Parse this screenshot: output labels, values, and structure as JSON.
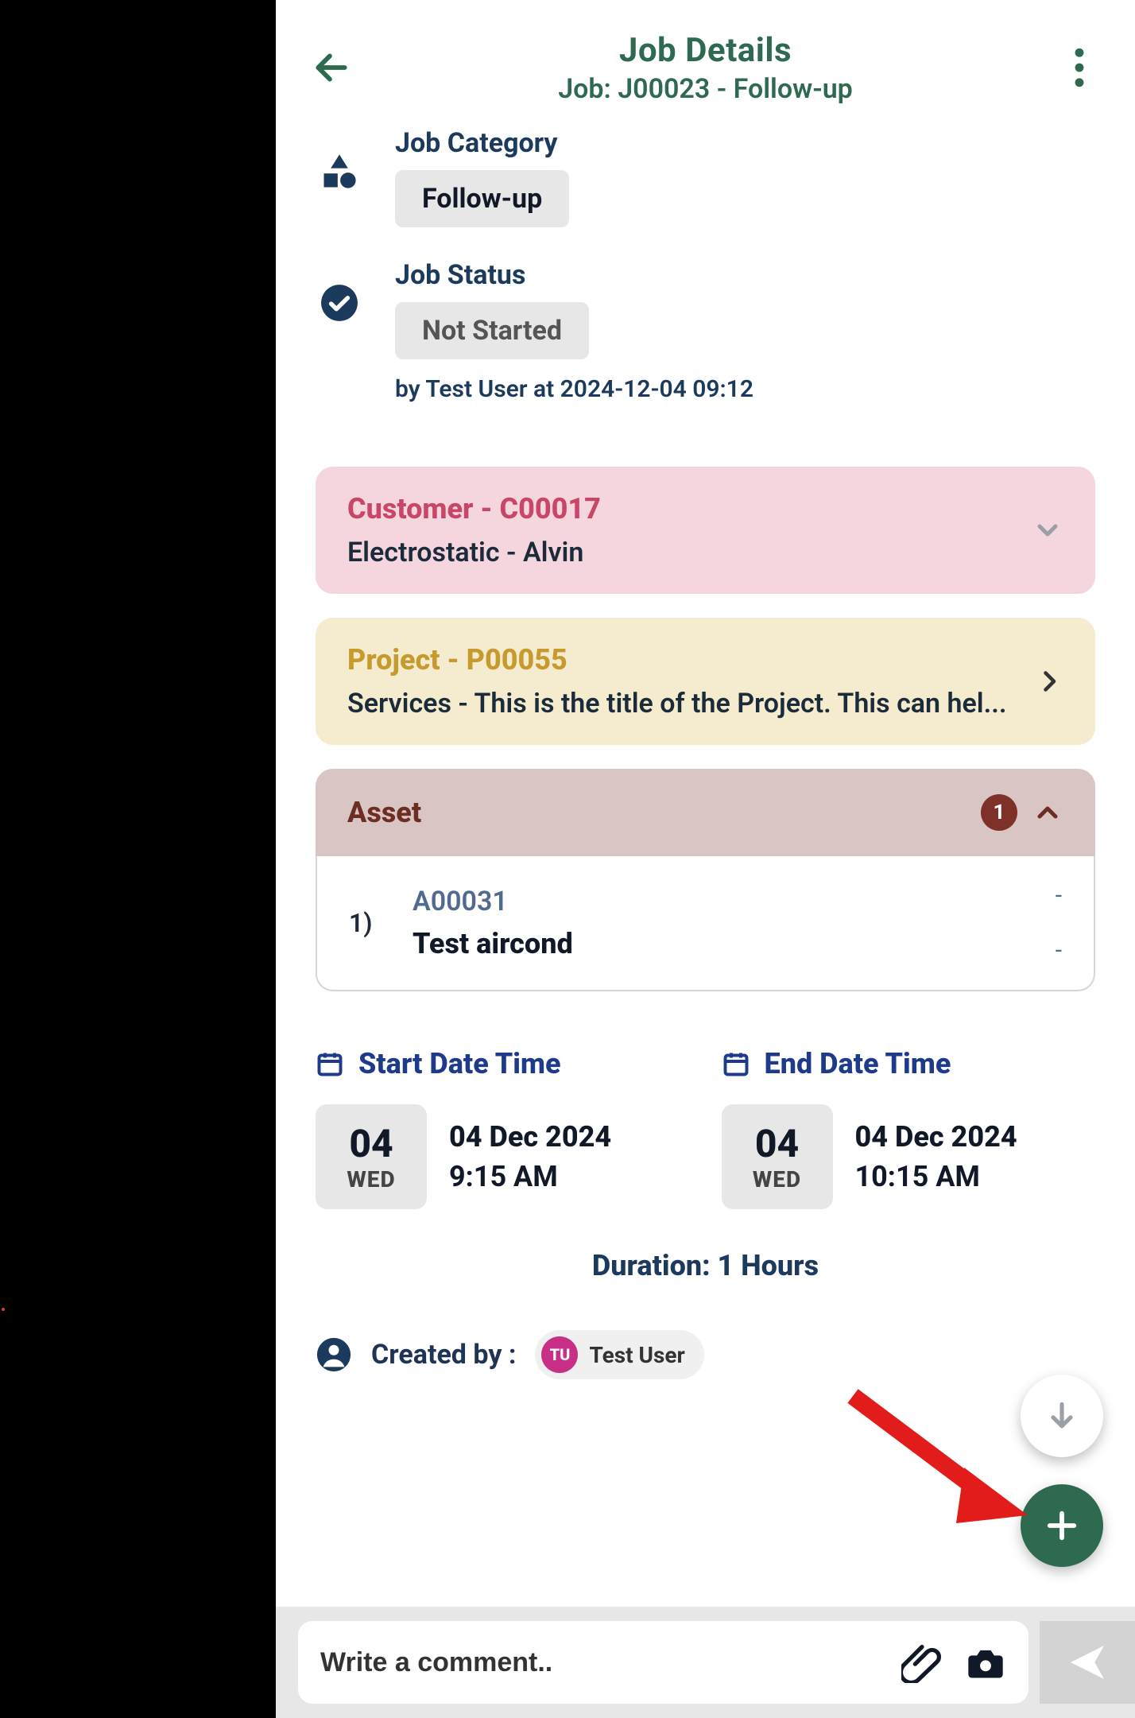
{
  "header": {
    "title": "Job Details",
    "subtitle": "Job: J00023 - Follow-up"
  },
  "meta": {
    "category_label": "Job Category",
    "category_value": "Follow-up",
    "status_label": "Job Status",
    "status_value": "Not Started",
    "status_byline": "by Test User at 2024-12-04 09:12"
  },
  "customer": {
    "title": "Customer  -  C00017",
    "sub": "Electrostatic  - Alvin"
  },
  "project": {
    "title": "Project  -  P00055",
    "sub": "Services - This is the title of the Project. This can hel..."
  },
  "asset": {
    "title": "Asset",
    "count": "1",
    "items": [
      {
        "idx": "1)",
        "id": "A00031",
        "name": "Test aircond",
        "t1": "-",
        "t2": "-"
      }
    ]
  },
  "start": {
    "label": "Start Date Time",
    "daynum": "04",
    "dow": "WED",
    "date": "04 Dec 2024",
    "time": "9:15 AM"
  },
  "end": {
    "label": "End Date Time",
    "daynum": "04",
    "dow": "WED",
    "date": "04 Dec 2024",
    "time": "10:15 AM"
  },
  "duration": "Duration: 1 Hours",
  "created": {
    "label": "Created by :",
    "initials": "TU",
    "name": "Test User"
  },
  "comment": {
    "placeholder": "Write a comment.."
  }
}
